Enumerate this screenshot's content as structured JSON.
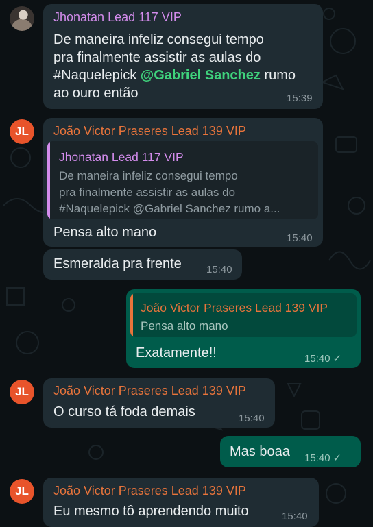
{
  "messages": [
    {
      "sender": "Jhonatan Lead 117 VIP",
      "lines": [
        "De maneira infeliz consegui tempo",
        "pra finalmente assistir as aulas do"
      ],
      "line3_pre": "#Naquelepick ",
      "mention": "@Gabriel Sanchez",
      "line3_post": " rumo",
      "line4": "ao ouro então",
      "time": "15:39"
    },
    {
      "avatar": "JL",
      "sender": "João Victor Praseres Lead 139 VIP",
      "quote_sender": "Jhonatan Lead 117 VIP",
      "quote_lines": [
        "De maneira infeliz consegui tempo",
        "pra finalmente assistir as aulas do",
        "#Naquelepick @Gabriel Sanchez rumo a..."
      ],
      "text": "Pensa alto mano",
      "time": "15:40"
    },
    {
      "text": "Esmeralda pra frente",
      "time": "15:40"
    },
    {
      "quote_sender": "João Victor Praseres Lead 139 VIP",
      "quote_text": "Pensa alto mano",
      "text": "Exatamente!!",
      "time": "15:40",
      "status": "✓"
    },
    {
      "avatar": "JL",
      "sender": "João Victor Praseres Lead 139 VIP",
      "text": "O curso tá foda demais",
      "time": "15:40"
    },
    {
      "text": "Mas boaa",
      "time": "15:40",
      "status": "✓"
    },
    {
      "avatar": "JL",
      "sender": "João Victor Praseres Lead 139 VIP",
      "text": "Eu mesmo tô aprendendo muito",
      "time": "15:40"
    }
  ],
  "colors": {
    "background": "#0c1114",
    "incoming_bubble": "#1f2c33",
    "outgoing_bubble": "#005c4b",
    "sender_purple": "#d38cec",
    "sender_orange": "#e8743b",
    "mention_green": "#3fd27c",
    "avatar_orange": "#e8542b"
  },
  "icons": {
    "read_status": "single-check-icon",
    "avatar_photo": "user-photo-avatar"
  }
}
